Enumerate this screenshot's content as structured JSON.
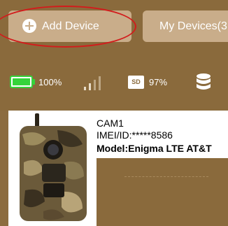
{
  "tabs": {
    "add_device_label": "Add Device",
    "my_devices_label": "My Devices(3"
  },
  "status": {
    "battery_text": "100%",
    "battery_level": 1.0,
    "sd_icon_text": "SD",
    "sd_text": "97%"
  },
  "device": {
    "name": "CAM1",
    "imei": "IMEI/ID:*****8586",
    "model": "Model:Enigma LTE AT&T"
  },
  "colors": {
    "app_background": "#8a6a3c",
    "tab_background": "#c9ad8a",
    "battery_green": "#35d33a",
    "highlight_red": "#d21c1c"
  }
}
